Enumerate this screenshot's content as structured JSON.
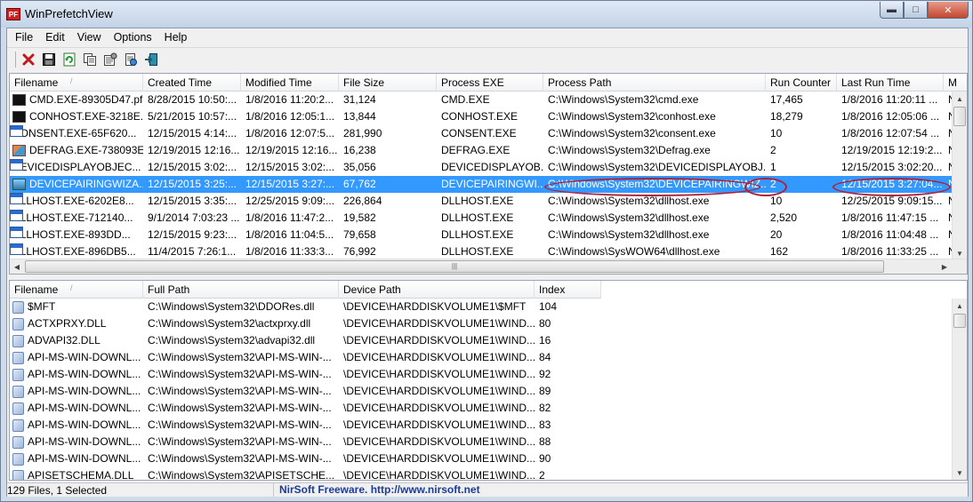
{
  "window": {
    "title": "WinPrefetchView",
    "icon_text": "PF",
    "controls": [
      "minimize-icon",
      "maximize-icon",
      "close-icon"
    ]
  },
  "menu": [
    "File",
    "Edit",
    "View",
    "Options",
    "Help"
  ],
  "toolbar": {
    "buttons": [
      "delete-icon",
      "save-icon",
      "refresh-icon",
      "copy-icon",
      "properties-icon",
      "html-report-icon",
      "exit-icon"
    ]
  },
  "top_table": {
    "columns": [
      "Filename",
      "Created Time",
      "Modified Time",
      "File Size",
      "Process EXE",
      "Process Path",
      "Run Counter",
      "Last Run Time",
      "M"
    ],
    "sorted_column": "Filename",
    "rows": [
      {
        "icon": "cmd",
        "cells": [
          "CMD.EXE-89305D47.pf",
          "8/28/2015 10:50:...",
          "1/8/2016 11:20:2...",
          "31,124",
          "CMD.EXE",
          "C:\\Windows\\System32\\cmd.exe",
          "17,465",
          "1/8/2016 11:20:11 ...",
          "N"
        ]
      },
      {
        "icon": "cmd",
        "cells": [
          "CONHOST.EXE-3218E...",
          "5/21/2015 10:57:...",
          "1/8/2016 12:05:1...",
          "13,844",
          "CONHOST.EXE",
          "C:\\Windows\\System32\\conhost.exe",
          "18,279",
          "1/8/2016 12:05:06 ...",
          "N"
        ]
      },
      {
        "icon": "win",
        "cells": [
          "CONSENT.EXE-65F620...",
          "12/15/2015 4:14:...",
          "1/8/2016 12:07:5...",
          "281,990",
          "CONSENT.EXE",
          "C:\\Windows\\System32\\consent.exe",
          "10",
          "1/8/2016 12:07:54 ...",
          "N"
        ]
      },
      {
        "icon": "dfg",
        "cells": [
          "DEFRAG.EXE-738093E...",
          "12/19/2015 12:16...",
          "12/19/2015 12:16...",
          "16,238",
          "DEFRAG.EXE",
          "C:\\Windows\\System32\\Defrag.exe",
          "2",
          "12/19/2015 12:19:2...",
          "N"
        ]
      },
      {
        "icon": "win",
        "cells": [
          "DEVICEDISPLAYOBJEC...",
          "12/15/2015 3:02:...",
          "12/15/2015 3:02:...",
          "35,056",
          "DEVICEDISPLAYOB...",
          "C:\\Windows\\System32\\DEVICEDISPLAYOBJ...",
          "1",
          "12/15/2015 3:02:20...",
          "N"
        ]
      },
      {
        "icon": "pair",
        "selected": true,
        "cells": [
          "DEVICEPAIRINGWIZA...",
          "12/15/2015 3:25:...",
          "12/15/2015 3:27:...",
          "67,762",
          "DEVICEPAIRINGWI...",
          "C:\\Windows\\System32\\DEVICEPAIRINGWIZ...",
          "2",
          "12/15/2015 3:27:04...",
          "N"
        ]
      },
      {
        "icon": "win",
        "cells": [
          "DLLHOST.EXE-6202E8...",
          "12/15/2015 3:35:...",
          "12/25/2015 9:09:...",
          "226,864",
          "DLLHOST.EXE",
          "C:\\Windows\\System32\\dllhost.exe",
          "10",
          "12/25/2015 9:09:15...",
          "N"
        ]
      },
      {
        "icon": "win",
        "cells": [
          "DLLHOST.EXE-712140...",
          "9/1/2014 7:03:23 ...",
          "1/8/2016 11:47:2...",
          "19,582",
          "DLLHOST.EXE",
          "C:\\Windows\\System32\\dllhost.exe",
          "2,520",
          "1/8/2016 11:47:15 ...",
          "N"
        ]
      },
      {
        "icon": "win",
        "cells": [
          "DLLHOST.EXE-893DD...",
          "12/15/2015 9:23:...",
          "1/8/2016 11:04:5...",
          "79,658",
          "DLLHOST.EXE",
          "C:\\Windows\\System32\\dllhost.exe",
          "20",
          "1/8/2016 11:04:48 ...",
          "N"
        ]
      },
      {
        "icon": "win",
        "cells": [
          "DLLHOST.EXE-896DB5...",
          "11/4/2015 7:26:1...",
          "1/8/2016 11:33:3...",
          "76,992",
          "DLLHOST.EXE",
          "C:\\Windows\\SysWOW64\\dllhost.exe",
          "162",
          "1/8/2016 11:33:25 ...",
          "N"
        ]
      }
    ]
  },
  "bottom_table": {
    "columns": [
      "Filename",
      "Full Path",
      "Device Path",
      "Index"
    ],
    "sorted_column": "Filename",
    "rows": [
      [
        "$MFT",
        "C:\\Windows\\System32\\DDORes.dll",
        "\\DEVICE\\HARDDISKVOLUME1\\$MFT",
        "104"
      ],
      [
        "ACTXPRXY.DLL",
        "C:\\Windows\\System32\\actxprxy.dll",
        "\\DEVICE\\HARDDISKVOLUME1\\WIND...",
        "80"
      ],
      [
        "ADVAPI32.DLL",
        "C:\\Windows\\System32\\advapi32.dll",
        "\\DEVICE\\HARDDISKVOLUME1\\WIND...",
        "16"
      ],
      [
        "API-MS-WIN-DOWNL...",
        "C:\\Windows\\System32\\API-MS-WIN-...",
        "\\DEVICE\\HARDDISKVOLUME1\\WIND...",
        "84"
      ],
      [
        "API-MS-WIN-DOWNL...",
        "C:\\Windows\\System32\\API-MS-WIN-...",
        "\\DEVICE\\HARDDISKVOLUME1\\WIND...",
        "92"
      ],
      [
        "API-MS-WIN-DOWNL...",
        "C:\\Windows\\System32\\API-MS-WIN-...",
        "\\DEVICE\\HARDDISKVOLUME1\\WIND...",
        "89"
      ],
      [
        "API-MS-WIN-DOWNL...",
        "C:\\Windows\\System32\\API-MS-WIN-...",
        "\\DEVICE\\HARDDISKVOLUME1\\WIND...",
        "82"
      ],
      [
        "API-MS-WIN-DOWNL...",
        "C:\\Windows\\System32\\API-MS-WIN-...",
        "\\DEVICE\\HARDDISKVOLUME1\\WIND...",
        "83"
      ],
      [
        "API-MS-WIN-DOWNL...",
        "C:\\Windows\\System32\\API-MS-WIN-...",
        "\\DEVICE\\HARDDISKVOLUME1\\WIND...",
        "88"
      ],
      [
        "API-MS-WIN-DOWNL...",
        "C:\\Windows\\System32\\API-MS-WIN-...",
        "\\DEVICE\\HARDDISKVOLUME1\\WIND...",
        "90"
      ],
      [
        "APISETSCHEMA.DLL",
        "C:\\Windows\\System32\\APISETSCHE...",
        "\\DEVICE\\HARDDISKVOLUME1\\WIND...",
        "2"
      ]
    ]
  },
  "status": {
    "files_summary": "129 Files, 1 Selected",
    "credit": "NirSoft Freeware.  http://www.nirsoft.net"
  },
  "colors": {
    "selection": "#3399ff",
    "annotation": "#b0203a",
    "credit_link": "#1b3c9a"
  }
}
